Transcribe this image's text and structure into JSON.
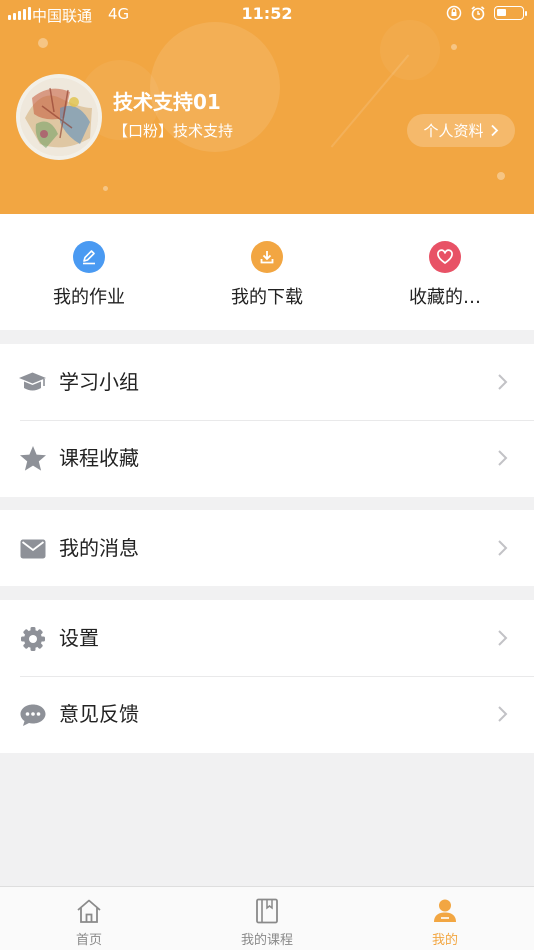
{
  "status_bar": {
    "carrier": "中国联通",
    "network": "4G",
    "time": "11:52"
  },
  "profile": {
    "username": "技术支持01",
    "tag": "【口粉】技术支持",
    "profile_button": "个人资料",
    "header_color": "#f2a642"
  },
  "shortcuts": [
    {
      "label": "我的作业",
      "icon": "pencil-icon",
      "color": "#4a9af2"
    },
    {
      "label": "我的下载",
      "icon": "download-icon",
      "color": "#f2a642"
    },
    {
      "label": "收藏的…",
      "icon": "heart-icon",
      "color": "#e85266"
    }
  ],
  "menu": {
    "study_group": "学习小组",
    "course_favorites": "课程收藏",
    "my_messages": "我的消息",
    "settings": "设置",
    "feedback": "意见反馈"
  },
  "tabbar": {
    "home": "首页",
    "my_courses": "我的课程",
    "mine": "我的",
    "active_color": "#f2a642"
  }
}
